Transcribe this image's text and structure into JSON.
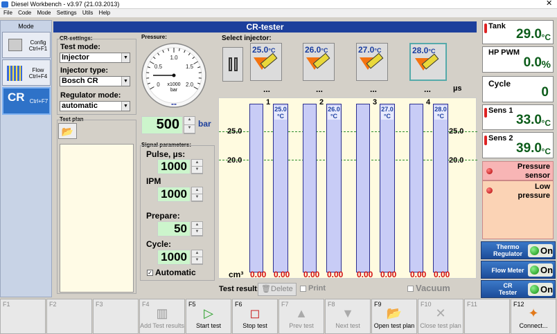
{
  "window": {
    "title": "Diesel Workbench - v3.97 (21.03.2013)",
    "close": "✕"
  },
  "menu": [
    "File",
    "Code",
    "Mode",
    "Settings",
    "Utils",
    "Help"
  ],
  "mode": {
    "title": "Mode",
    "buttons": [
      {
        "label": "Config\nCtrl+F1"
      },
      {
        "label": "Flow\nCtrl+F4"
      },
      {
        "big": "CR",
        "label": "Ctrl+F7"
      }
    ]
  },
  "header": "CR-tester",
  "settings": {
    "title": "CR-settings:",
    "test_mode_label": "Test mode:",
    "test_mode_value": "Injector",
    "injector_type_label": "Injector type:",
    "injector_type_value": "Bosch CR",
    "regulator_label": "Regulator mode:",
    "regulator_value": "automatic",
    "test_plan_label": "Test plan"
  },
  "pressure": {
    "label": "Pressure:",
    "gauge_ticks": [
      "0",
      "0.5",
      "1.0",
      "1.5",
      "2.0"
    ],
    "gauge_unit1": "x1000",
    "gauge_unit2": "bar",
    "gauge_reading": "--",
    "value": "500",
    "unit": "bar",
    "gauge_value_fraction": 0.125
  },
  "signal": {
    "label": "Signal parameters:",
    "pulse_label": "Pulse, µs:",
    "pulse_value": "1000",
    "ipm_label": "IPM",
    "ipm_value": "1000",
    "prepare_label": "Prepare:",
    "prepare_value": "50",
    "cycle_label": "Cycle:",
    "cycle_value": "1000",
    "automatic_label": "Automatic",
    "automatic_checked": true
  },
  "injectors": {
    "label": "Select injector:",
    "pause_icon": "pause-icon",
    "items": [
      {
        "temp": "25.0",
        "unit": "°C",
        "dots": "..."
      },
      {
        "temp": "26.0",
        "unit": "°C",
        "dots": "..."
      },
      {
        "temp": "27.0",
        "unit": "°C",
        "dots": "..."
      },
      {
        "temp": "28.0",
        "unit": "°C",
        "dots": "..."
      }
    ],
    "us_label": "µs"
  },
  "tubes": {
    "numbers": [
      "1",
      "2",
      "3",
      "4"
    ],
    "temps": [
      {
        "t": "25.0",
        "u": "°C"
      },
      {
        "t": "26.0",
        "u": "°C"
      },
      {
        "t": "27.0",
        "u": "°C"
      },
      {
        "t": "28.0",
        "u": "°C"
      }
    ],
    "gridlines": [
      "25.0",
      "20.0"
    ],
    "cm3_label": "cm³",
    "values": [
      "0.00",
      "0.00",
      "0.00",
      "0.00",
      "0.00",
      "0.00",
      "0.00",
      "0.00"
    ]
  },
  "results": {
    "label": "Test result:",
    "delete": "Delete",
    "print": "Print",
    "vacuum": "Vacuum"
  },
  "status": {
    "tank": {
      "label": "Tank",
      "value": "29.0",
      "unit": "°C"
    },
    "hp_pwm": {
      "label": "HP PWM",
      "value": "0.0",
      "unit": "%"
    },
    "cycle": {
      "label": "Cycle",
      "value": "0"
    },
    "sens1": {
      "label": "Sens 1",
      "value": "33.0",
      "unit": "°C"
    },
    "sens2": {
      "label": "Sens 2",
      "value": "39.0",
      "unit": "°C"
    },
    "alarm1": "Pressure\nsensor",
    "alarm2": "Low\npressure"
  },
  "toggles": [
    {
      "label": "Thermo\nRegulator",
      "state": "On"
    },
    {
      "label": "Flow Meter",
      "state": "On"
    },
    {
      "label": "CR\nTester",
      "state": "On"
    }
  ],
  "fkeys": [
    {
      "key": "F1",
      "label": "",
      "enabled": false,
      "icon": ""
    },
    {
      "key": "F2",
      "label": "",
      "enabled": false,
      "icon": ""
    },
    {
      "key": "F3",
      "label": "",
      "enabled": false,
      "icon": ""
    },
    {
      "key": "F4",
      "label": "Add Test results",
      "enabled": false,
      "icon": "add-results-icon"
    },
    {
      "key": "F5",
      "label": "Start test",
      "enabled": true,
      "icon": "play-icon"
    },
    {
      "key": "F6",
      "label": "Stop test",
      "enabled": true,
      "icon": "stop-icon"
    },
    {
      "key": "F7",
      "label": "Prev test",
      "enabled": false,
      "icon": "up-arrow-icon"
    },
    {
      "key": "F8",
      "label": "Next test",
      "enabled": false,
      "icon": "down-arrow-icon"
    },
    {
      "key": "F9",
      "label": "Open test plan",
      "enabled": true,
      "icon": "folder-icon"
    },
    {
      "key": "F10",
      "label": "Close test plan",
      "enabled": false,
      "icon": "close-icon"
    },
    {
      "key": "F11",
      "label": "",
      "enabled": false,
      "icon": ""
    },
    {
      "key": "F12",
      "label": "Connect...",
      "enabled": true,
      "icon": "connect-icon"
    }
  ],
  "colors": {
    "accent": "#1c3f9c",
    "value_green": "#0c5c1a",
    "alarm": "#f8b5b5",
    "tube": "#c8ccf6",
    "chart_bg": "#fffbe0"
  }
}
